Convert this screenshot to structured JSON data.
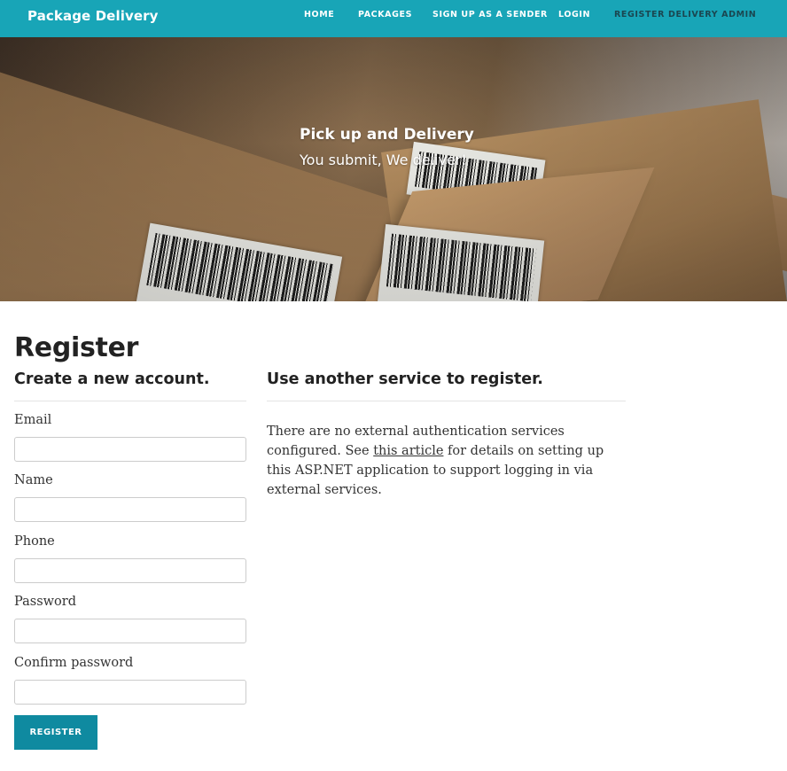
{
  "navbar": {
    "brand": "Package Delivery",
    "links": [
      {
        "label": "HOME"
      },
      {
        "label": "PACKAGES"
      },
      {
        "label": "SIGN UP AS A SENDER"
      },
      {
        "label": "LOGIN"
      },
      {
        "label": "REGISTER DELIVERY ADMIN"
      }
    ],
    "bg_color": "#18a5b7",
    "active_link_color": "#1a4650"
  },
  "hero": {
    "title": "Pick up and Delivery",
    "subtitle": "You submit, We deliver!"
  },
  "main": {
    "title": "Register",
    "form": {
      "heading": "Create a new account.",
      "fields": [
        {
          "label": "Email",
          "value": "",
          "placeholder": ""
        },
        {
          "label": "Name",
          "value": "",
          "placeholder": ""
        },
        {
          "label": "Phone",
          "value": "",
          "placeholder": ""
        },
        {
          "label": "Password",
          "value": "",
          "placeholder": ""
        },
        {
          "label": "Confirm password",
          "value": "",
          "placeholder": ""
        }
      ],
      "submit_label": "REGISTER",
      "submit_color": "#0f8aa0"
    },
    "external": {
      "heading": "Use another service to register.",
      "text_before": "There are no external authentication services configured. See ",
      "link_text": "this article",
      "text_after": " for details on setting up this ASP.NET application to support logging in via external services."
    }
  }
}
